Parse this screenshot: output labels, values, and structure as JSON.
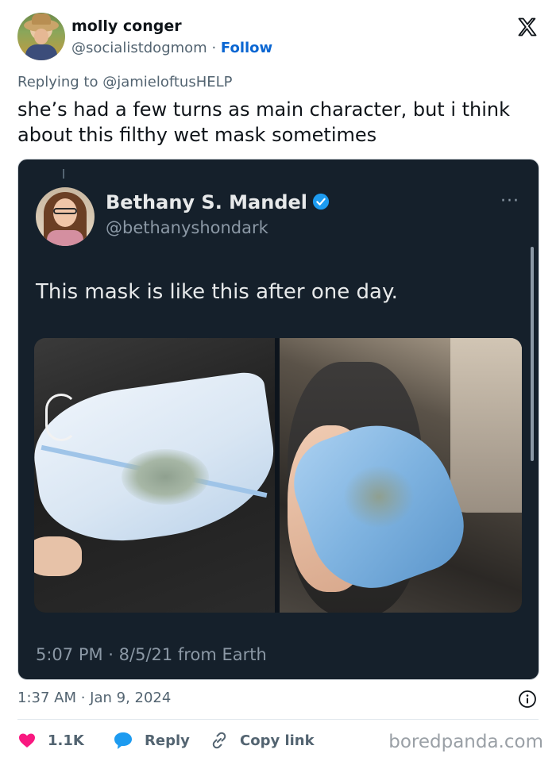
{
  "author": {
    "name": "molly conger",
    "handle": "@socialistdogmom",
    "separator": "·",
    "follow_label": "Follow"
  },
  "reply_context": "Replying to @jamieloftusHELP",
  "tweet_text": "she’s had a few turns as main character, but i think about this filthy wet mask sometimes",
  "embedded": {
    "name": "Bethany S. Mandel",
    "handle": "@bethanyshondark",
    "more": "···",
    "text": "This mask is like this after one day.",
    "timestamp": "5:07 PM · 8/5/21 from Earth"
  },
  "meta": {
    "timestamp": "1:37 AM · Jan 9, 2024"
  },
  "actions": {
    "likes": "1.1K",
    "reply_label": "Reply",
    "copy_label": "Copy link"
  },
  "watermark": "boredpanda.com",
  "colors": {
    "follow": "#0a66d2",
    "like_heart": "#f91880",
    "reply_bubble": "#1d9bf0",
    "verified_badge": "#1d9bf0",
    "card_bg": "#15202b"
  }
}
